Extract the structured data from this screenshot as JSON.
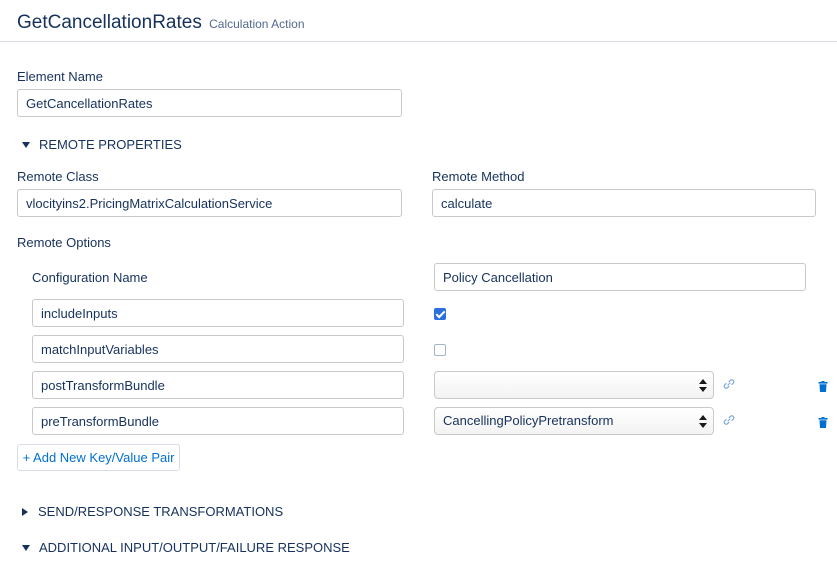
{
  "header": {
    "title": "GetCancellationRates",
    "subtitle": "Calculation Action"
  },
  "element_name": {
    "label": "Element Name",
    "value": "GetCancellationRates"
  },
  "remote_properties": {
    "section_label": "REMOTE PROPERTIES",
    "expanded": true,
    "remote_class": {
      "label": "Remote Class",
      "value": "vlocityins2.PricingMatrixCalculationService"
    },
    "remote_method": {
      "label": "Remote Method",
      "value": "calculate"
    },
    "remote_options": {
      "label": "Remote Options",
      "configuration_name": {
        "label": "Configuration Name",
        "value": "Policy Cancellation"
      },
      "rows": [
        {
          "key": "includeInputs",
          "type": "checkbox",
          "checked": true
        },
        {
          "key": "matchInputVariables",
          "type": "checkbox",
          "checked": false
        },
        {
          "key": "postTransformBundle",
          "type": "select",
          "value": ""
        },
        {
          "key": "preTransformBundle",
          "type": "select",
          "value": "CancellingPolicyPretransform"
        }
      ],
      "add_button_label": "+ Add New Key/Value Pair"
    }
  },
  "sections": {
    "send_response": {
      "label": "SEND/RESPONSE TRANSFORMATIONS",
      "expanded": false
    },
    "additional": {
      "label": "ADDITIONAL INPUT/OUTPUT/FAILURE RESPONSE",
      "expanded": true
    }
  },
  "colors": {
    "text": "#16325c",
    "link": "#0070d2",
    "checkbox_checked": "#2a6fdb",
    "border": "#c9c9c9",
    "link_icon": "#7fa9d6"
  },
  "icons": {
    "link": "link-icon",
    "delete": "trash-icon",
    "expand": "caret-down-icon",
    "collapse": "caret-right-icon"
  }
}
